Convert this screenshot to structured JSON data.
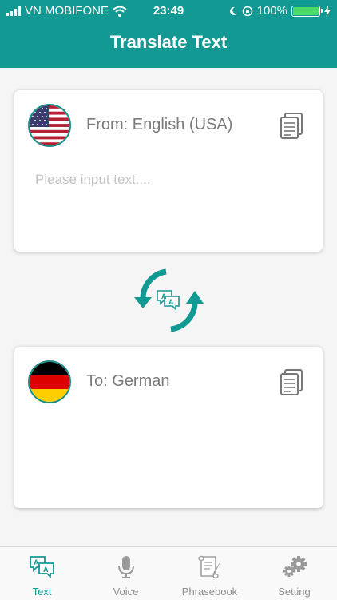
{
  "status_bar": {
    "carrier": "VN MOBIFONE",
    "time": "23:49",
    "battery": "100%"
  },
  "header": {
    "title": "Translate Text"
  },
  "from_card": {
    "language": "From: English (USA)",
    "placeholder": "Please input text....",
    "flag": "usa-flag-icon"
  },
  "to_card": {
    "language": "To: German",
    "flag": "germany-flag-icon"
  },
  "tabs": [
    {
      "label": "Text",
      "icon": "translate-icon",
      "active": true
    },
    {
      "label": "Voice",
      "icon": "microphone-icon",
      "active": false
    },
    {
      "label": "Phrasebook",
      "icon": "scroll-quill-icon",
      "active": false
    },
    {
      "label": "Setting",
      "icon": "gears-icon",
      "active": false
    }
  ],
  "colors": {
    "primary": "#139993",
    "inactive": "#8e8e8e"
  }
}
